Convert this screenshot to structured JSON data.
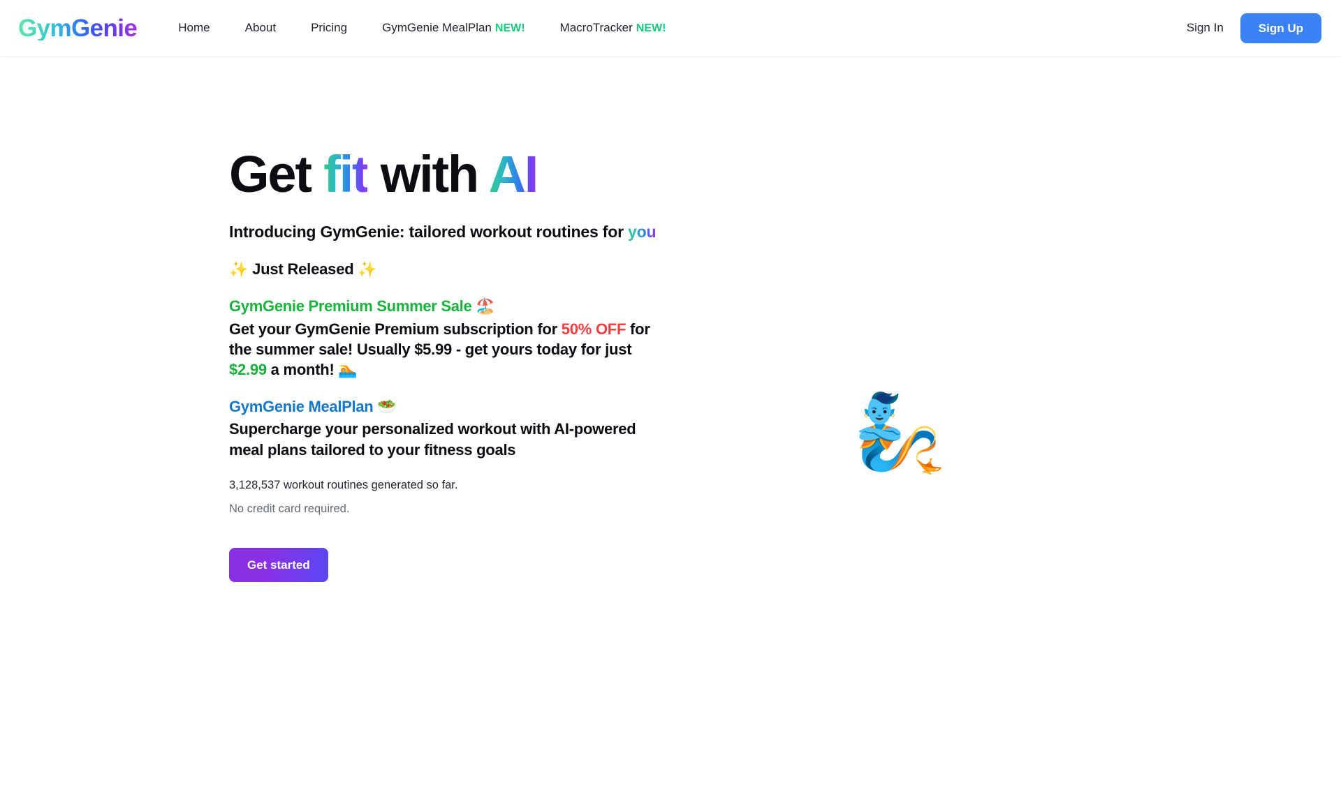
{
  "header": {
    "brand": "GymGenie",
    "nav": [
      {
        "label": "Home",
        "badge": ""
      },
      {
        "label": "About",
        "badge": ""
      },
      {
        "label": "Pricing",
        "badge": ""
      },
      {
        "label": "GymGenie MealPlan",
        "badge": "NEW!"
      },
      {
        "label": "MacroTracker",
        "badge": "NEW!"
      }
    ],
    "sign_in_label": "Sign In",
    "sign_up_label": "Sign Up",
    "colors": {
      "new_badge": "#18c97e",
      "signup_bg": "#3b82f6",
      "brand_gradient_start": "#5ee6a8",
      "brand_gradient_end": "#a032e0"
    }
  },
  "hero": {
    "title": {
      "part1": "Get ",
      "accent1": "fit",
      "part2": " with ",
      "accent2": "AI"
    },
    "subtitle": {
      "text": "Introducing GymGenie: tailored workout routines for ",
      "accent": "you"
    },
    "just_released": "✨ Just Released ✨",
    "promos": [
      {
        "heading": "GymGenie Premium Summer Sale 🏖️",
        "heading_color": "#19b23c",
        "body_part1": "Get your GymGenie Premium subscription for ",
        "body_hl1": "50% OFF",
        "body_part2": " for the summer sale! Usually $5.99 - get yours today for just ",
        "body_hl2": "$2.99",
        "body_part3": " a month! 🏊"
      },
      {
        "heading": "GymGenie MealPlan 🥗",
        "heading_color": "#1577c9",
        "body_part1": "Supercharge your personalized workout with AI-powered meal plans tailored to your fitness goals",
        "body_hl1": "",
        "body_part2": "",
        "body_hl2": "",
        "body_part3": ""
      }
    ],
    "stats_line": "3,128,537 workout routines generated so far.",
    "no_card_line": "No credit card required.",
    "cta_label": "Get started",
    "art_emoji": "🧞",
    "colors": {
      "highlight_red": "#f63d3d",
      "highlight_green": "#17b23c",
      "cta_gradient_start": "#8b2fe6",
      "cta_gradient_end": "#5b46f5"
    }
  }
}
